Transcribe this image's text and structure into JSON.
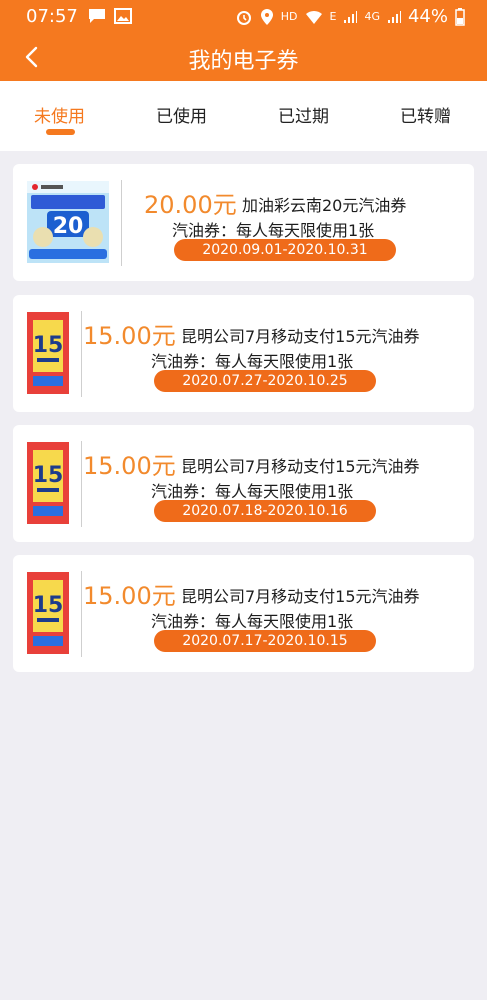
{
  "status_bar": {
    "time": "07:57",
    "network_label": "HD",
    "network_type_1": "E",
    "network_type_2": "4G",
    "battery_percent": "44%"
  },
  "header": {
    "title": "我的电子券",
    "back_icon": "chevron-left-icon"
  },
  "tabs": [
    {
      "label": "未使用",
      "active": true
    },
    {
      "label": "已使用",
      "active": false
    },
    {
      "label": "已过期",
      "active": false
    },
    {
      "label": "已转赠",
      "active": false
    }
  ],
  "colors": {
    "brand": "#f5791f",
    "price": "#f28a2d",
    "pill": "#ef6b1a",
    "background": "#efeef3"
  },
  "coupons": [
    {
      "price": "20.00元",
      "name": "加油彩云南20元汽油券",
      "rule": "汽油券：每人每天限使用1张",
      "validity": "2020.09.01-2020.10.31"
    },
    {
      "price": "15.00元",
      "name": "昆明公司7月移动支付15元汽油券",
      "rule": "汽油券：每人每天限使用1张",
      "validity": "2020.07.27-2020.10.25"
    },
    {
      "price": "15.00元",
      "name": "昆明公司7月移动支付15元汽油券",
      "rule": "汽油券：每人每天限使用1张",
      "validity": "2020.07.18-2020.10.16"
    },
    {
      "price": "15.00元",
      "name": "昆明公司7月移动支付15元汽油券",
      "rule": "汽油券：每人每天限使用1张",
      "validity": "2020.07.17-2020.10.15"
    }
  ]
}
